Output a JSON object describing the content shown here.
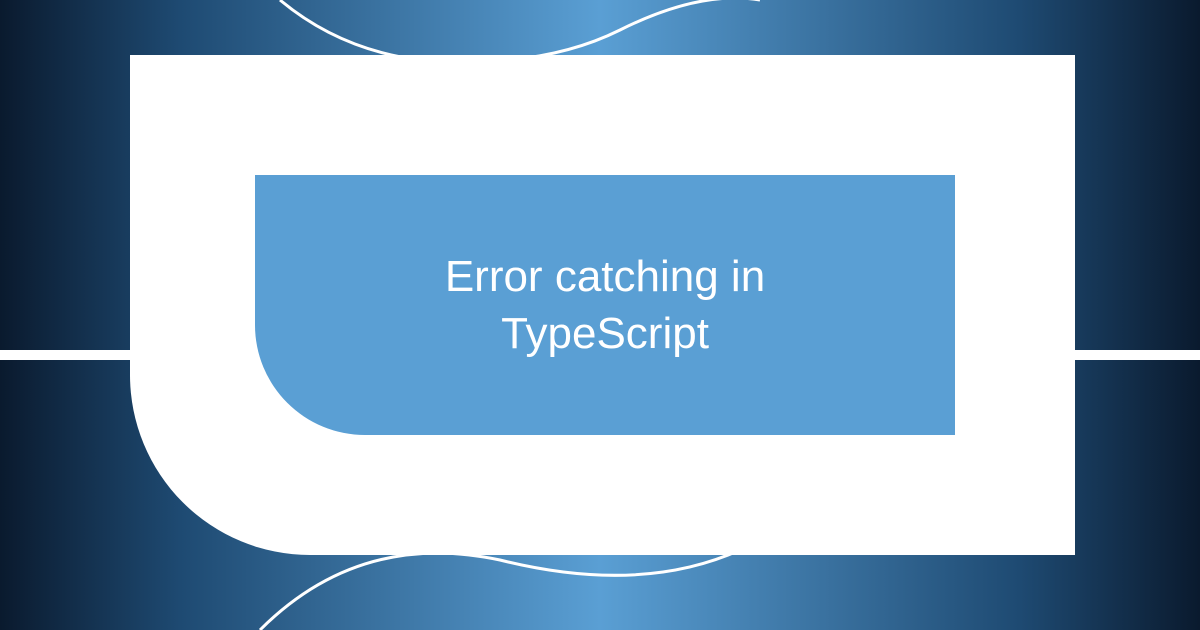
{
  "card": {
    "title": "Error catching in TypeScript"
  },
  "colors": {
    "background_dark": "#0a1a2e",
    "background_mid": "#1e4a72",
    "accent": "#5a9fd4",
    "shape": "#ffffff"
  }
}
